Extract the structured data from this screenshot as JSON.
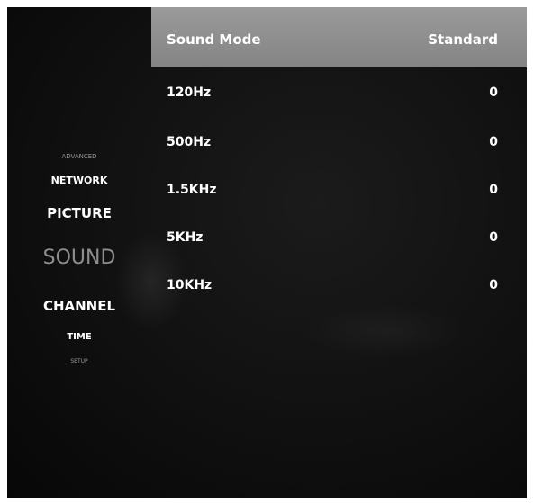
{
  "menu": {
    "items": [
      {
        "label": "ADVANCED"
      },
      {
        "label": "NETWORK"
      },
      {
        "label": "PICTURE"
      },
      {
        "label": "SOUND"
      },
      {
        "label": "CHANNEL"
      },
      {
        "label": "TIME"
      },
      {
        "label": "SETUP"
      }
    ],
    "selected": "SOUND"
  },
  "settings": {
    "header": {
      "label": "Sound Mode",
      "value": "Standard"
    },
    "rows": [
      {
        "label": "120Hz",
        "value": "0"
      },
      {
        "label": "500Hz",
        "value": "0"
      },
      {
        "label": "1.5KHz",
        "value": "0"
      },
      {
        "label": "5KHz",
        "value": "0"
      },
      {
        "label": "10KHz",
        "value": "0"
      }
    ]
  },
  "colors": {
    "background": "#101010",
    "header_highlight": "#8f8f8f",
    "text": "#ffffff",
    "selected_category": "#8e8e8e"
  }
}
